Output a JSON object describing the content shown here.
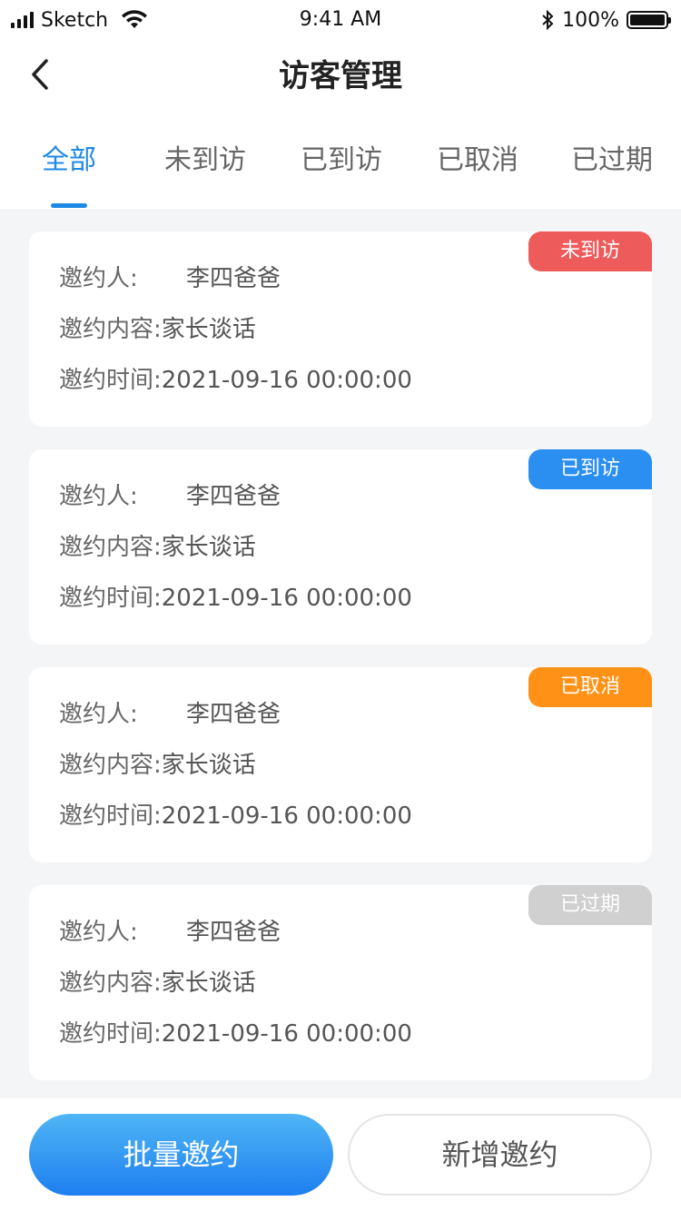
{
  "status_bar": {
    "carrier": "Sketch",
    "time": "9:41 AM",
    "battery": "100%"
  },
  "nav": {
    "title": "访客管理",
    "back_icon": "chevron-left-icon"
  },
  "tabs": [
    {
      "label": "全部",
      "active": true
    },
    {
      "label": "未到访",
      "active": false
    },
    {
      "label": "已到访",
      "active": false
    },
    {
      "label": "已取消",
      "active": false
    },
    {
      "label": "已过期",
      "active": false
    }
  ],
  "labels": {
    "inviter": "邀约人:",
    "content": "邀约内容:",
    "time": "邀约时间:"
  },
  "cards": [
    {
      "status": "未到访",
      "status_color": "#ee5b5b",
      "inviter": "李四爸爸",
      "content": "家长谈话",
      "time": "2021-09-16 00:00:00"
    },
    {
      "status": "已到访",
      "status_color": "#2b8ff2",
      "inviter": "李四爸爸",
      "content": "家长谈话",
      "time": "2021-09-16 00:00:00"
    },
    {
      "status": "已取消",
      "status_color": "#ff9216",
      "inviter": "李四爸爸",
      "content": "家长谈话",
      "time": "2021-09-16 00:00:00"
    },
    {
      "status": "已过期",
      "status_color": "#d0d0d0",
      "inviter": "李四爸爸",
      "content": "家长谈话",
      "time": "2021-09-16 00:00:00"
    }
  ],
  "buttons": {
    "batch_invite": "批量邀约",
    "new_invite": "新增邀约"
  },
  "colors": {
    "accent": "#1e88e5"
  }
}
